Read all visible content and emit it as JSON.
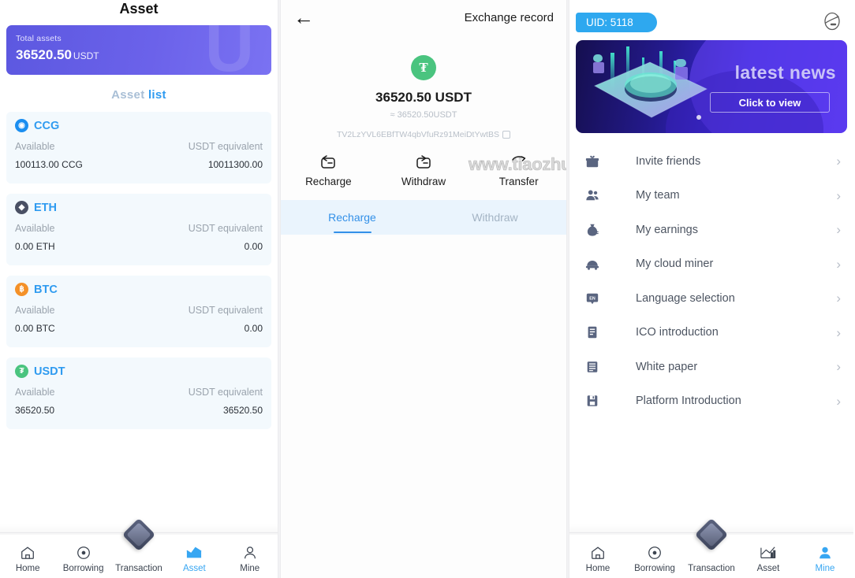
{
  "left": {
    "title": "Asset",
    "total_card": {
      "label": "Total assets",
      "value": "36520.50",
      "unit": "USDT",
      "ghost": "U",
      "bg": "#5c58e0"
    },
    "asset_list_heading": {
      "part1": "Asset",
      "part2": "list"
    },
    "column_labels": {
      "available": "Available",
      "equivalent": "USDT equivalent"
    },
    "coins": [
      {
        "symbol": "CCG",
        "glyph": "◉",
        "color": "#1b8ef0",
        "available_label": "Available",
        "equivalent_label": "USDT equivalent",
        "available": "100113.00  CCG",
        "equivalent": "10011300.00"
      },
      {
        "symbol": "ETH",
        "glyph": "◆",
        "color": "#4a5064",
        "available_label": "Available",
        "equivalent_label": "USDT equivalent",
        "available": "0.00  ETH",
        "equivalent": "0.00"
      },
      {
        "symbol": "BTC",
        "glyph": "฿",
        "color": "#f49128",
        "available_label": "Available",
        "equivalent_label": "USDT equivalent",
        "available": "0.00  BTC",
        "equivalent": "0.00"
      },
      {
        "symbol": "USDT",
        "glyph": "₮",
        "color": "#4ac47f",
        "available_label": "Available",
        "equivalent_label": "USDT equivalent",
        "available": "36520.50",
        "equivalent": "36520.50"
      }
    ],
    "tabbar": [
      {
        "label": "Home",
        "icon": "home-icon",
        "active": false
      },
      {
        "label": "Borrowing",
        "icon": "circle-target-icon",
        "active": false
      },
      {
        "label": "Transaction",
        "icon": "diamond-icon",
        "active": false
      },
      {
        "label": "Asset",
        "icon": "chart-icon",
        "active": true
      },
      {
        "label": "Mine",
        "icon": "person-icon",
        "active": false
      }
    ]
  },
  "middle": {
    "back_icon": "back-arrow-icon",
    "title": "Exchange record",
    "coin_logo": "tether-icon",
    "amount": "36520.50 USDT",
    "approx": "≈ 36520.50USDT",
    "address": "TV2LzYVL6EBfTW4qbVfuRz91MeiDtYwtBS",
    "copy_icon": "copy-icon",
    "actions": [
      {
        "label": "Recharge",
        "icon": "recharge-icon"
      },
      {
        "label": "Withdraw",
        "icon": "withdraw-icon"
      },
      {
        "label": "Transfer",
        "icon": "transfer-icon"
      }
    ],
    "tabs": [
      {
        "label": "Recharge",
        "active": true
      },
      {
        "label": "Withdraw",
        "active": false
      }
    ],
    "accent": "#3390e8"
  },
  "watermark": "www.tiaozhuan.net",
  "right": {
    "uid": "UID: 5118",
    "service_icon": "headset-icon",
    "banner": {
      "title": "latest news",
      "button": "Click to view"
    },
    "menu": [
      {
        "label": "Invite friends",
        "icon": "gift-icon"
      },
      {
        "label": "My team",
        "icon": "team-icon"
      },
      {
        "label": "My earnings",
        "icon": "money-bag-icon"
      },
      {
        "label": "My cloud miner",
        "icon": "miner-icon"
      },
      {
        "label": "Language selection",
        "icon": "language-icon"
      },
      {
        "label": "ICO introduction",
        "icon": "document-icon"
      },
      {
        "label": "White paper",
        "icon": "paper-icon"
      },
      {
        "label": "Platform Introduction",
        "icon": "save-icon"
      }
    ],
    "chevron": "›",
    "tabbar": [
      {
        "label": "Home",
        "icon": "home-icon",
        "active": false
      },
      {
        "label": "Borrowing",
        "icon": "circle-target-icon",
        "active": false
      },
      {
        "label": "Transaction",
        "icon": "diamond-icon",
        "active": false
      },
      {
        "label": "Asset",
        "icon": "chart-icon",
        "active": false
      },
      {
        "label": "Mine",
        "icon": "person-icon",
        "active": true
      }
    ]
  }
}
